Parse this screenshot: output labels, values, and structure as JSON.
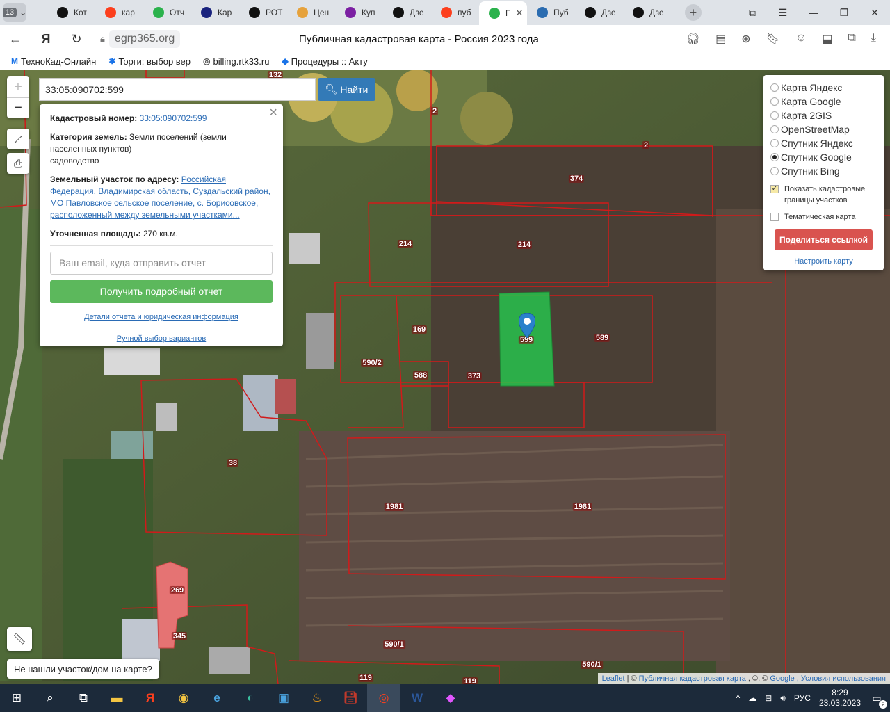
{
  "browser": {
    "tab_count": "13",
    "tabs": [
      {
        "label": "Кот",
        "icon": "compass-icon",
        "color": "#111111"
      },
      {
        "label": "кар",
        "icon": "yandex-icon",
        "color": "#fc3f1d"
      },
      {
        "label": "Отч",
        "icon": "check-icon",
        "color": "#2bb24c"
      },
      {
        "label": "Кар",
        "icon": "map-icon",
        "color": "#1a237e"
      },
      {
        "label": "РОТ",
        "icon": "compass-icon",
        "color": "#111111"
      },
      {
        "label": "Цен",
        "icon": "bag-icon",
        "color": "#e6a23c"
      },
      {
        "label": "Куп",
        "icon": "wb-icon",
        "color": "#7b1fa2"
      },
      {
        "label": "Дзе",
        "icon": "compass-icon",
        "color": "#111111"
      },
      {
        "label": "пуб",
        "icon": "yandex-icon",
        "color": "#fc3f1d"
      },
      {
        "label": "Г",
        "icon": "check-icon",
        "color": "#2bb24c",
        "active": true
      },
      {
        "label": "Пуб",
        "icon": "doc-icon",
        "color": "#2b6cb0"
      },
      {
        "label": "Дзе",
        "icon": "compass-icon",
        "color": "#111111"
      },
      {
        "label": "Дзе",
        "icon": "compass-icon",
        "color": "#111111"
      }
    ],
    "url": "egrp365.org",
    "page_title": "Публичная кадастровая карта - Россия 2023 года",
    "bookmarks": [
      {
        "label": "ТехноКад-Онлайн",
        "icon": "M"
      },
      {
        "label": "Торги: выбор вер",
        "icon": "✱"
      },
      {
        "label": "billing.rtk33.ru",
        "icon": "◎"
      },
      {
        "label": "Процедуры :: Акту",
        "icon": "◆"
      }
    ]
  },
  "map": {
    "search_value": "33:05:090702:599",
    "search_button": "Найти",
    "zoom_in": "+",
    "zoom_out": "−",
    "info": {
      "cadastral_label": "Кадастровый номер:",
      "cadastral_value": "33:05:090702:599",
      "category_label": "Категория земель:",
      "category_value": "Земли поселений (земли населенных пунктов)",
      "use": "садоводство",
      "address_label": "Земельный участок по адресу:",
      "address_value": "Российская Федерация, Владимирская область, Суздальский район, МО Павловское сельское поселение, с. Борисовское, расположенный между земельными участками...",
      "area_label": "Уточненная площадь:",
      "area_value": "270 кв.м.",
      "email_placeholder": "Ваш email, куда отправить отчет",
      "report_button": "Получить подробный отчет",
      "details_link": "Детали отчета и юридическая информация",
      "manual_link": "Ручной выбор вариантов"
    },
    "layers": [
      {
        "label": "Карта Яндекс",
        "selected": false
      },
      {
        "label": "Карта Google",
        "selected": false
      },
      {
        "label": "Карта 2GIS",
        "selected": false
      },
      {
        "label": "OpenStreetMap",
        "selected": false
      },
      {
        "label": "Спутник Яндекс",
        "selected": false
      },
      {
        "label": "Спутник Google",
        "selected": true
      },
      {
        "label": "Спутник Bing",
        "selected": false
      }
    ],
    "show_boundaries": "Показать кадастровые границы участков",
    "thematic": "Тематическая карта",
    "share_button": "Поделиться ссылкой",
    "tune_link": "Настроить карту",
    "not_found": "Не нашли участок/дом на карте?",
    "attribution": {
      "leaflet": "Leaflet",
      "sep1": "| ©",
      "pkk": "Публичная кадастровая карта",
      "sep2": ", ©, ©",
      "google": "Google",
      "terms": ", Условия использования"
    },
    "parcel_labels": [
      "132",
      "2",
      "2",
      "374",
      "214",
      "214",
      "169",
      "590/2",
      "588",
      "373",
      "599",
      "589",
      "38",
      "1981",
      "1981",
      "269",
      "345",
      "590/1",
      "590/1",
      "119",
      "119"
    ],
    "colors": {
      "boundary": "#d11a1a",
      "selected_parcel": "#27c24c",
      "pink_parcel": "#e57373"
    }
  },
  "taskbar": {
    "lang": "РУС",
    "time": "8:29",
    "date": "23.03.2023",
    "notifications": "2"
  }
}
